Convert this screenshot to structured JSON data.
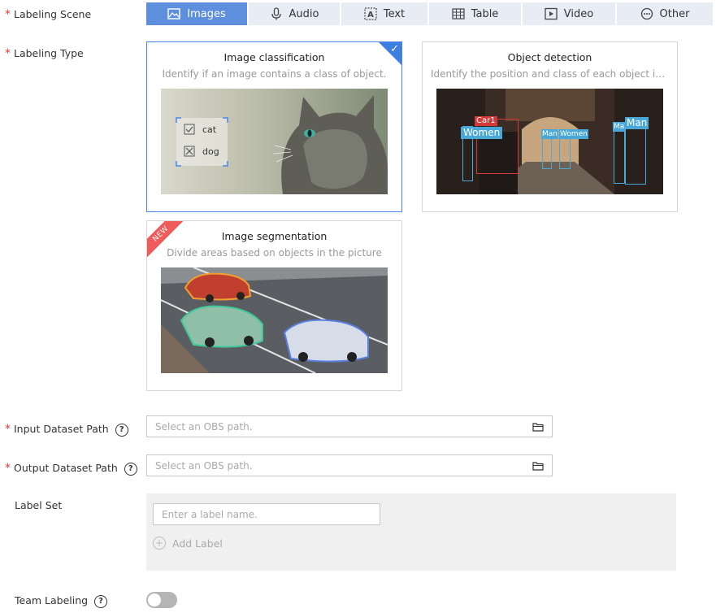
{
  "form": {
    "labeling_scene_label": "Labeling Scene",
    "labeling_type_label": "Labeling Type",
    "input_path_label": "Input Dataset Path",
    "output_path_label": "Output Dataset Path",
    "label_set_label": "Label Set",
    "team_labeling_label": "Team Labeling",
    "required_mark": "*",
    "help_glyph": "?"
  },
  "scene_tabs": [
    {
      "label": "Images",
      "icon": "image-icon",
      "active": true
    },
    {
      "label": "Audio",
      "icon": "microphone-icon",
      "active": false
    },
    {
      "label": "Text",
      "icon": "text-icon",
      "active": false
    },
    {
      "label": "Table",
      "icon": "table-icon",
      "active": false
    },
    {
      "label": "Video",
      "icon": "video-icon",
      "active": false
    },
    {
      "label": "Other",
      "icon": "more-icon",
      "active": false
    }
  ],
  "type_cards": [
    {
      "title": "Image classification",
      "description": "Identify if an image contains a class of object.",
      "selected": true,
      "overlay_labels": [
        "cat",
        "dog"
      ]
    },
    {
      "title": "Object detection",
      "description": "Identify the position and class of each object in an i...",
      "selected": false,
      "overlay_labels": [
        "Car1",
        "Women",
        "Man",
        "Women",
        "Ma",
        "Man"
      ]
    },
    {
      "title": "Image segmentation",
      "description": "Divide areas based on objects in the picture",
      "selected": false,
      "badge": "NEW"
    }
  ],
  "input_path": {
    "placeholder": "Select an OBS path.",
    "value": ""
  },
  "output_path": {
    "placeholder": "Select an OBS path.",
    "value": ""
  },
  "label_set": {
    "input_placeholder": "Enter a label name.",
    "add_label": "Add Label"
  },
  "team_labeling": {
    "enabled": false
  },
  "colors": {
    "accent": "#5d8fdc",
    "selected_border": "#4a86e8",
    "required": "#e53935",
    "badge": "#f05a5a"
  }
}
